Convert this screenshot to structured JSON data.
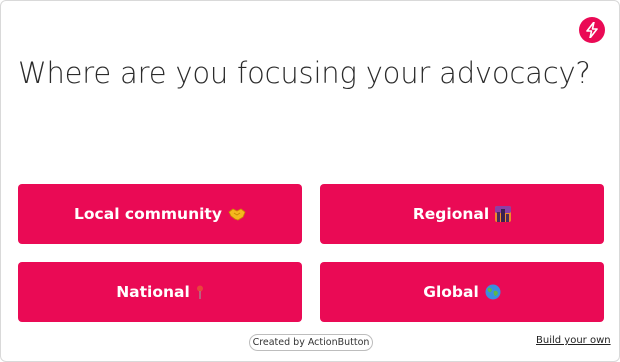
{
  "question": "Where are you focusing your advocacy?",
  "brand_color": "#ea0a55",
  "logo_icon": "lightning-bolt-icon",
  "options": [
    {
      "label": "Local community",
      "emoji_icon": "handshake-emoji-icon"
    },
    {
      "label": "Regional",
      "emoji_icon": "city-dusk-emoji-icon"
    },
    {
      "label": "National",
      "emoji_icon": "pin-emoji-icon"
    },
    {
      "label": "Global",
      "emoji_icon": "globe-emoji-icon"
    }
  ],
  "footer": {
    "credit": "Created by ActionButton",
    "build_link": "Build your own"
  }
}
